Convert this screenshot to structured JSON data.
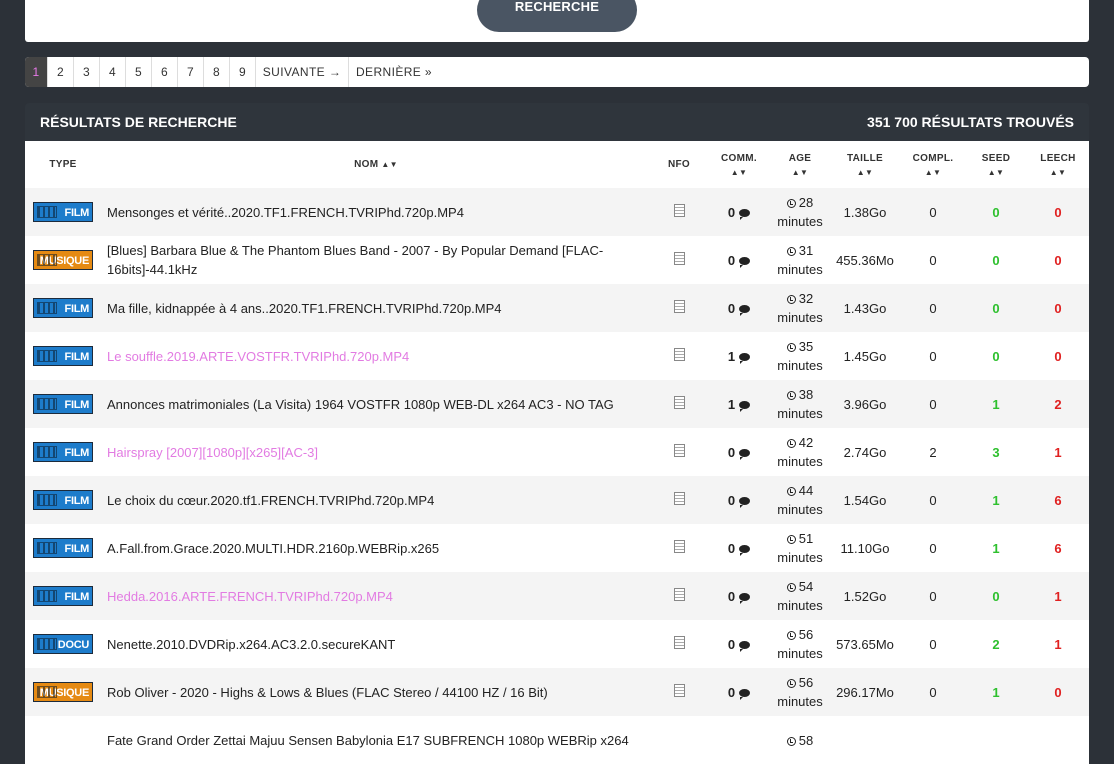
{
  "search": {
    "button_label": "RECHERCHE"
  },
  "pagination": {
    "pages": [
      "1",
      "2",
      "3",
      "4",
      "5",
      "6",
      "7",
      "8",
      "9"
    ],
    "next": "SUIVANTE →",
    "last": "DERNIÈRE »"
  },
  "results": {
    "title": "RÉSULTATS DE RECHERCHE",
    "count": "351 700 RÉSULTATS TROUVÉS"
  },
  "columns": {
    "type": "TYPE",
    "nom": "NOM",
    "nfo": "NFO",
    "comm": "COMM.",
    "age": "AGE",
    "taille": "TAILLE",
    "compl": "COMPL.",
    "seed": "SEED",
    "leech": "LEECH"
  },
  "rows": [
    {
      "type": "FILM",
      "name": "Mensonges et vérité..2020.TF1.FRENCH.TVRIPhd.720p.MP4",
      "comm": "0",
      "age_num": "28",
      "age_unit": "minutes",
      "size": "1.38Go",
      "compl": "0",
      "seed": "0",
      "leech": "0"
    },
    {
      "type": "MUSIQUE",
      "name": "[Blues] Barbara Blue & The Phantom Blues Band - 2007 - By Popular Demand [FLAC-16bits]-44.1kHz",
      "comm": "0",
      "age_num": "31",
      "age_unit": "minutes",
      "size": "455.36Mo",
      "compl": "0",
      "seed": "0",
      "leech": "0"
    },
    {
      "type": "FILM",
      "name": "Ma fille, kidnappée à 4 ans..2020.TF1.FRENCH.TVRIPhd.720p.MP4",
      "comm": "0",
      "age_num": "32",
      "age_unit": "minutes",
      "size": "1.43Go",
      "compl": "0",
      "seed": "0",
      "leech": "0"
    },
    {
      "type": "FILM",
      "name": "Le souffle.2019.ARTE.VOSTFR.TVRIPhd.720p.MP4",
      "comm": "1",
      "age_num": "35",
      "age_unit": "minutes",
      "size": "1.45Go",
      "compl": "0",
      "seed": "0",
      "leech": "0",
      "visited": true
    },
    {
      "type": "FILM",
      "name": "Annonces matrimoniales (La Visita) 1964 VOSTFR 1080p WEB-DL x264 AC3 - NO TAG",
      "comm": "1",
      "age_num": "38",
      "age_unit": "minutes",
      "size": "3.96Go",
      "compl": "0",
      "seed": "1",
      "leech": "2"
    },
    {
      "type": "FILM",
      "name": "Hairspray [2007][1080p][x265][AC-3]",
      "comm": "0",
      "age_num": "42",
      "age_unit": "minutes",
      "size": "2.74Go",
      "compl": "2",
      "seed": "3",
      "leech": "1",
      "visited": true
    },
    {
      "type": "FILM",
      "name": "Le choix du cœur.2020.tf1.FRENCH.TVRIPhd.720p.MP4",
      "comm": "0",
      "age_num": "44",
      "age_unit": "minutes",
      "size": "1.54Go",
      "compl": "0",
      "seed": "1",
      "leech": "6"
    },
    {
      "type": "FILM",
      "name": "A.Fall.from.Grace.2020.MULTI.HDR.2160p.WEBRip.x265",
      "comm": "0",
      "age_num": "51",
      "age_unit": "minutes",
      "size": "11.10Go",
      "compl": "0",
      "seed": "1",
      "leech": "6"
    },
    {
      "type": "FILM",
      "name": "Hedda.2016.ARTE.FRENCH.TVRIPhd.720p.MP4",
      "comm": "0",
      "age_num": "54",
      "age_unit": "minutes",
      "size": "1.52Go",
      "compl": "0",
      "seed": "0",
      "leech": "1",
      "visited": true
    },
    {
      "type": "DOCU",
      "name": "Nenette.2010.DVDRip.x264.AC3.2.0.secureKANT",
      "comm": "0",
      "age_num": "56",
      "age_unit": "minutes",
      "size": "573.65Mo",
      "compl": "0",
      "seed": "2",
      "leech": "1"
    },
    {
      "type": "MUSIQUE",
      "name": "Rob Oliver - 2020 - Highs & Lows & Blues (FLAC Stereo / 44100 HZ / 16 Bit)",
      "comm": "0",
      "age_num": "56",
      "age_unit": "minutes",
      "size": "296.17Mo",
      "compl": "0",
      "seed": "1",
      "leech": "0"
    },
    {
      "type": "",
      "name": "Fate Grand Order Zettai Majuu Sensen Babylonia E17 SUBFRENCH 1080p WEBRip x264",
      "comm": "",
      "age_num": "58",
      "age_unit": "",
      "size": "",
      "compl": "",
      "seed": "",
      "leech": ""
    }
  ]
}
